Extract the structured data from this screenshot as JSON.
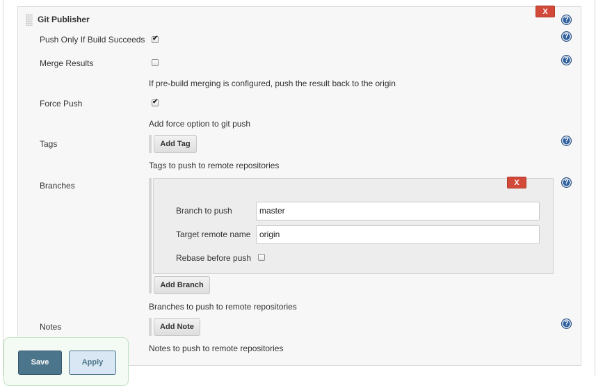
{
  "section": {
    "title": "Git Publisher",
    "delete_label": "X",
    "help_glyph": "?"
  },
  "fields": {
    "push_only_if_success": {
      "label": "Push Only If Build Succeeds",
      "checked": true
    },
    "merge_results": {
      "label": "Merge Results",
      "checked": false,
      "description": "If pre-build merging is configured, push the result back to the origin"
    },
    "force_push": {
      "label": "Force Push",
      "checked": true,
      "description": "Add force option to git push"
    },
    "tags": {
      "label": "Tags",
      "button": "Add Tag",
      "description": "Tags to push to remote repositories"
    },
    "branches": {
      "label": "Branches",
      "delete_label": "X",
      "branch_to_push": {
        "label": "Branch to push",
        "value": "master"
      },
      "target_remote": {
        "label": "Target remote name",
        "value": "origin"
      },
      "rebase": {
        "label": "Rebase before push",
        "checked": false
      },
      "button": "Add Branch",
      "description": "Branches to push to remote repositories"
    },
    "notes": {
      "label": "Notes",
      "button": "Add Note",
      "description": "Notes to push to remote repositories"
    }
  },
  "footer": {
    "save_label": "Save",
    "apply_label": "Apply"
  },
  "colors": {
    "delete_red": "#d24939",
    "help_blue": "#2c5d9c",
    "save_bg": "#4b758b",
    "apply_bg": "#d9e6f3"
  },
  "icons": {
    "help": "help-circle-icon",
    "drag": "drag-handle-icon"
  }
}
